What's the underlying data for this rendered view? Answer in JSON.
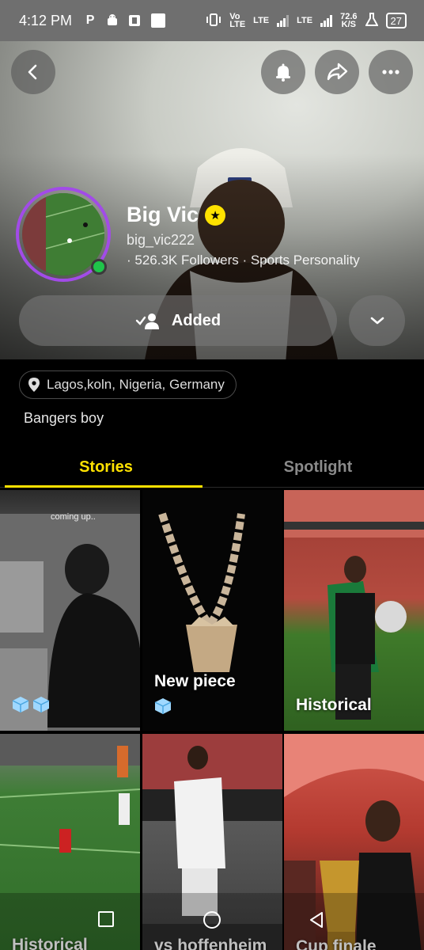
{
  "status_bar": {
    "time": "4:12 PM",
    "left_icons": [
      "p-icon",
      "android-icon",
      "office-icon",
      "square-icon"
    ],
    "net_label_1": "Vo\nLTE",
    "net_label_2": "LTE",
    "net_label_3": "LTE",
    "speed": "72.6\nK/S",
    "battery": "27"
  },
  "profile": {
    "name": "Big Vic",
    "username": "big_vic222",
    "meta": "· 526.3K Followers · Sports Personality",
    "added_label": "Added",
    "location": "Lagos,koln, Nigeria, Germany",
    "bio": "Bangers boy"
  },
  "tabs": [
    {
      "label": "Stories"
    },
    {
      "label": "Spotlight"
    }
  ],
  "tiles": [
    {
      "caption": "coming up..",
      "label": "",
      "cubes": 2
    },
    {
      "caption": "",
      "label": "New piece",
      "cubes": 1
    },
    {
      "caption": "",
      "label": "Historical",
      "cubes": 0
    },
    {
      "caption": "",
      "label": "Historical",
      "cubes": 0
    },
    {
      "caption": "",
      "label": "vs hoffenheim",
      "cubes": 0
    },
    {
      "caption": "",
      "label": "Cup finale",
      "cubes": 0
    }
  ],
  "colors": {
    "accent": "#ffe200",
    "ring": "#a24be8",
    "online": "#1fc44a"
  }
}
